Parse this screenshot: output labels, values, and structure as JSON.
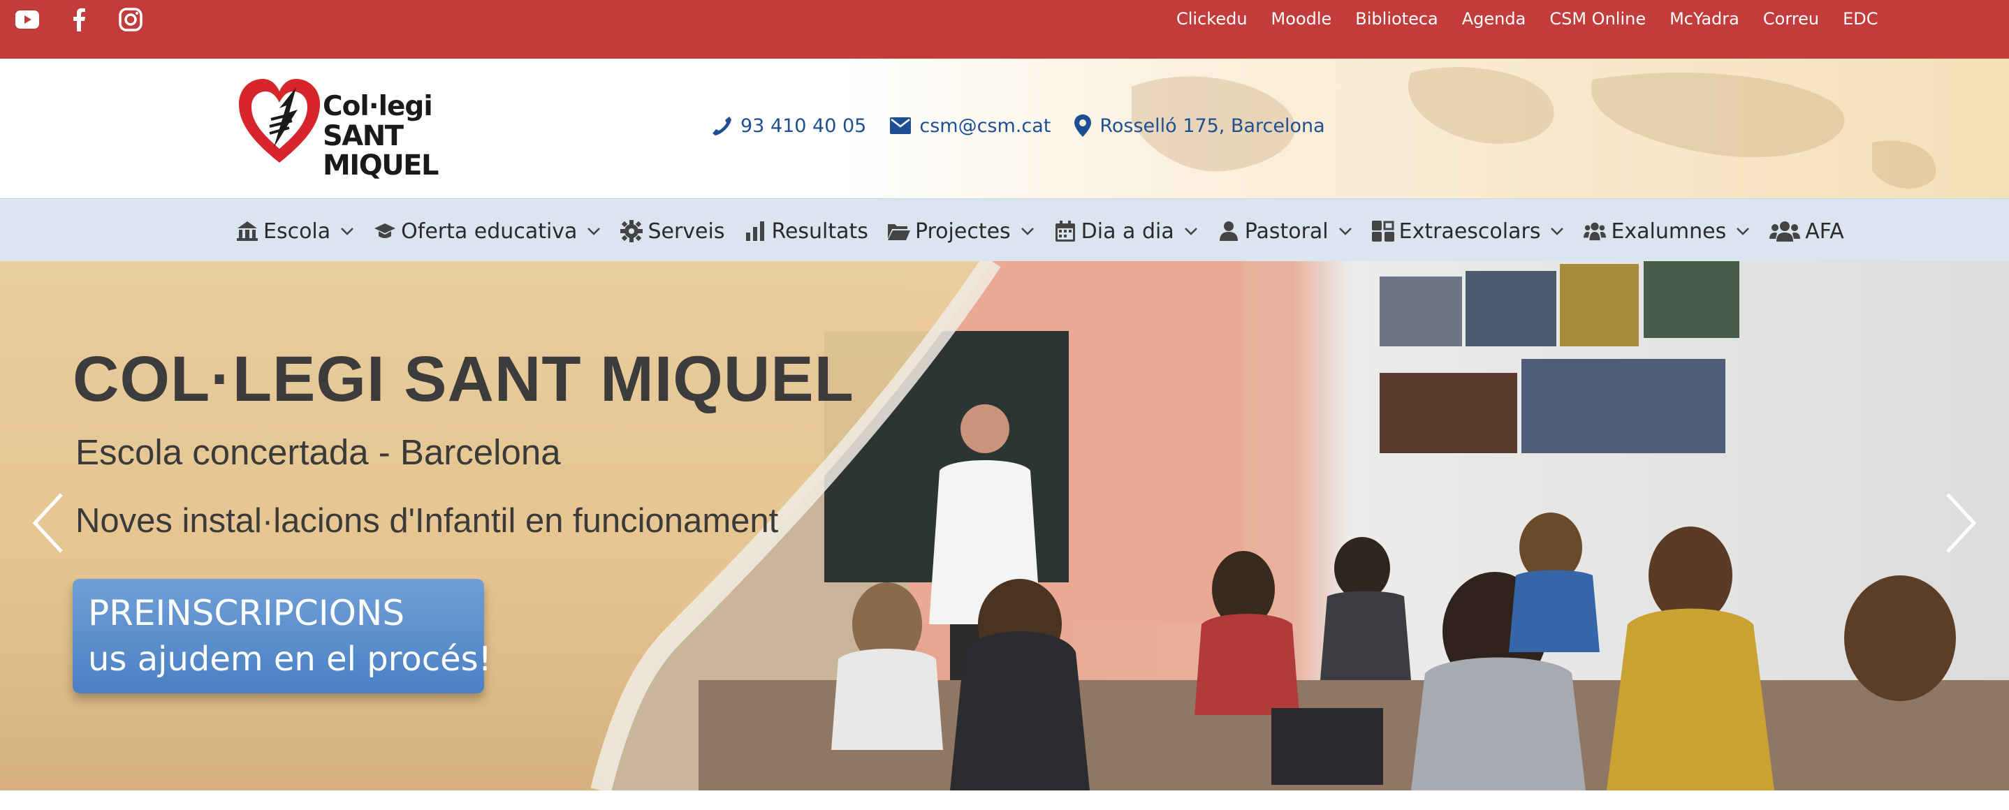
{
  "topbar": {
    "social_icons": [
      "youtube-icon",
      "facebook-icon",
      "instagram-icon"
    ],
    "links": [
      "Clickedu",
      "Moodle",
      "Biblioteca",
      "Agenda",
      "CSM Online",
      "McYadra",
      "Correu",
      "EDC"
    ],
    "background": "#c13c3a"
  },
  "header": {
    "logo": {
      "line1": "Col·legi",
      "line2": "SANT MIQUEL"
    },
    "contacts": {
      "phone": "93 410 40 05",
      "email": "csm@csm.cat",
      "address": "Rosselló 175, Barcelona"
    },
    "accent_color": "#1f4f93"
  },
  "nav": {
    "items": [
      {
        "label": "Escola",
        "icon": "school-icon",
        "dropdown": true
      },
      {
        "label": "Oferta educativa",
        "icon": "graduation-cap-icon",
        "dropdown": true
      },
      {
        "label": "Serveis",
        "icon": "gear-icon",
        "dropdown": false
      },
      {
        "label": "Resultats",
        "icon": "bar-chart-icon",
        "dropdown": false
      },
      {
        "label": "Projectes",
        "icon": "folder-open-icon",
        "dropdown": true
      },
      {
        "label": "Dia a dia",
        "icon": "calendar-icon",
        "dropdown": true
      },
      {
        "label": "Pastoral",
        "icon": "person-icon",
        "dropdown": true
      },
      {
        "label": "Extraescolars",
        "icon": "puzzle-icon",
        "dropdown": true
      },
      {
        "label": "Exalumnes",
        "icon": "group-icon",
        "dropdown": true
      },
      {
        "label": "AFA",
        "icon": "users-icon",
        "dropdown": false
      }
    ],
    "background": "#dae5f0"
  },
  "hero": {
    "title": "COL·LEGI SANT MIQUEL",
    "subtitle": "Escola concertada - Barcelona",
    "subtitle2": "Noves instal·lacions d'Infantil en funcionament",
    "cta": {
      "line1": "PREINSCRIPCIONS",
      "line2": "us ajudem en el procés!"
    },
    "cta_color": "#4a80c4"
  }
}
